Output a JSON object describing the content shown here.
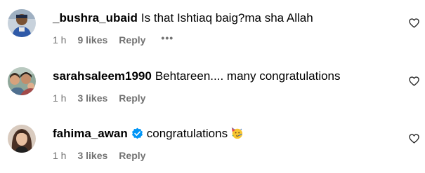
{
  "comments": [
    {
      "username": "_bushra_ubaid",
      "verified": false,
      "text": "Is that Ishtiaq baig?ma sha Allah",
      "time": "1 h",
      "likes": "9 likes",
      "reply": "Reply",
      "more": "•••"
    },
    {
      "username": "sarahsaleem1990",
      "verified": false,
      "text": "Behtareen.... many congratulations",
      "time": "1 h",
      "likes": "3 likes",
      "reply": "Reply"
    },
    {
      "username": "fahima_awan",
      "verified": true,
      "text": "congratulations",
      "emoji": "partying-face",
      "time": "1 h",
      "likes": "3 likes",
      "reply": "Reply"
    }
  ],
  "icons": {
    "like": "heart-outline-icon",
    "verified": "verified-badge-icon"
  },
  "colors": {
    "meta_text": "#737373",
    "verified_blue": "#0095f6",
    "text": "#000000"
  }
}
